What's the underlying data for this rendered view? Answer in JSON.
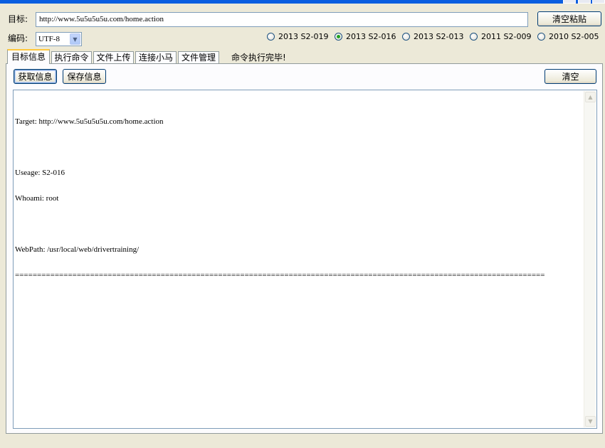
{
  "header": {
    "target_label": "目标:",
    "target_value": "http://www.5u5u5u5u.com/home.action",
    "clear_paste_label": "清空粘贴",
    "encoding_label": "编码:",
    "encoding_value": "UTF-8"
  },
  "exploits": [
    {
      "label": "2013 S2-019",
      "checked": false
    },
    {
      "label": "2013 S2-016",
      "checked": true
    },
    {
      "label": "2013 S2-013",
      "checked": false
    },
    {
      "label": "2011 S2-009",
      "checked": false
    },
    {
      "label": "2010 S2-005",
      "checked": false
    }
  ],
  "tabs": [
    {
      "label": "目标信息",
      "active": true
    },
    {
      "label": "执行命令",
      "active": false
    },
    {
      "label": "文件上传",
      "active": false
    },
    {
      "label": "连接小马",
      "active": false
    },
    {
      "label": "文件管理",
      "active": false
    }
  ],
  "status": "命令执行完毕!",
  "toolbar": {
    "get_info_label": "获取信息",
    "save_info_label": "保存信息",
    "clear_label": "清空"
  },
  "output": {
    "lines": [
      "Target: http://www.5u5u5u5u.com/home.action",
      "",
      "Useage: S2-016",
      "Whoami: root",
      "",
      "WebPath: /usr/local/web/drivertraining/",
      "========================================================================================================================"
    ]
  },
  "colors": {
    "window_bg": "#ece9d8",
    "titlebar": "#0a5ee0",
    "active_tab_accent": "#ffc83c",
    "radio_dot": "#21a121"
  }
}
